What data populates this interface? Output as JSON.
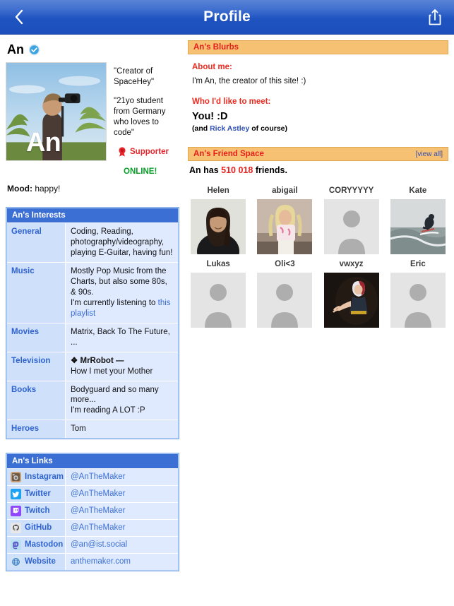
{
  "navbar": {
    "title": "Profile",
    "back_icon": "chevron-left-icon",
    "share_icon": "share-icon"
  },
  "profile": {
    "name": "An",
    "verified_icon": "verified-badge-icon",
    "photo_label": "An",
    "photo_alt": "person holding camera gimbal in front of palm trees",
    "quote1": "\"Creator of SpaceHey\"",
    "quote2": "\"21yo student from Germany who loves to code\"",
    "supporter_label": "Supporter",
    "supporter_icon": "award-rosette-icon",
    "online_label": "ONLINE!",
    "mood_label": "Mood:",
    "mood_value": "happy!"
  },
  "interests": {
    "title": "An's Interests",
    "rows": [
      {
        "key": "General",
        "value": "Coding, Reading, photography/videography, playing E-Guitar, having fun!"
      },
      {
        "key": "Music",
        "value": "Mostly Pop Music from the Charts, but also some 80s, & 90s.",
        "value2_prefix": "I'm currently listening to ",
        "value2_link": "this playlist"
      },
      {
        "key": "Movies",
        "value": "Matrix, Back To The Future, ..."
      },
      {
        "key": "Television",
        "value_title": "❖ MrRobot —",
        "value": "How I met your Mother"
      },
      {
        "key": "Books",
        "value": "Bodyguard and so many more...",
        "value2_prefix": "I'm reading A LOT :P"
      },
      {
        "key": "Heroes",
        "value": "Tom"
      }
    ]
  },
  "links": {
    "title": "An's Links",
    "rows": [
      {
        "icon": "instagram-icon",
        "key": "Instagram",
        "value": "@AnTheMaker"
      },
      {
        "icon": "twitter-icon",
        "key": "Twitter",
        "value": "@AnTheMaker"
      },
      {
        "icon": "twitch-icon",
        "key": "Twitch",
        "value": "@AnTheMaker"
      },
      {
        "icon": "github-icon",
        "key": "GitHub",
        "value": "@AnTheMaker"
      },
      {
        "icon": "mastodon-icon",
        "key": "Mastodon",
        "value": "@an@ist.social"
      },
      {
        "icon": "website-globe-icon",
        "key": "Website",
        "value": "anthemaker.com"
      }
    ]
  },
  "blurbs": {
    "title": "An's Blurbs",
    "about_heading": "About me:",
    "about_text": "I'm An, the creator of this site! :)",
    "meet_heading": "Who I'd like to meet:",
    "meet_big": "You! :D",
    "meet_sub_prefix": "(and ",
    "meet_sub_link": "Rick Astley",
    "meet_sub_suffix": " of course)"
  },
  "friend_space": {
    "title": "An's Friend Space",
    "view_all": "[view all]",
    "count_prefix": "An has ",
    "count": "510 018",
    "count_suffix": " friends.",
    "friends": [
      {
        "name": "Helen",
        "photo": "portrait-woman-dark-hair"
      },
      {
        "name": "abigail",
        "photo": "portrait-blonde-outdoors"
      },
      {
        "name": "CORYYYYY",
        "photo": "placeholder-avatar"
      },
      {
        "name": "Kate",
        "photo": "surfer-on-wave"
      },
      {
        "name": "Lukas",
        "photo": "placeholder-avatar"
      },
      {
        "name": "Oli<3",
        "photo": "placeholder-avatar"
      },
      {
        "name": "vwxyz",
        "photo": "anime-character-dark"
      },
      {
        "name": "Eric",
        "photo": "placeholder-avatar"
      }
    ]
  },
  "colors": {
    "navbar_blue": "#1f54c0",
    "table_header_blue": "#3b6fd4",
    "panel_orange": "#f6c173",
    "accent_red": "#e5201c",
    "online_green": "#0a9d28",
    "link_blue": "#3b6fd4"
  }
}
